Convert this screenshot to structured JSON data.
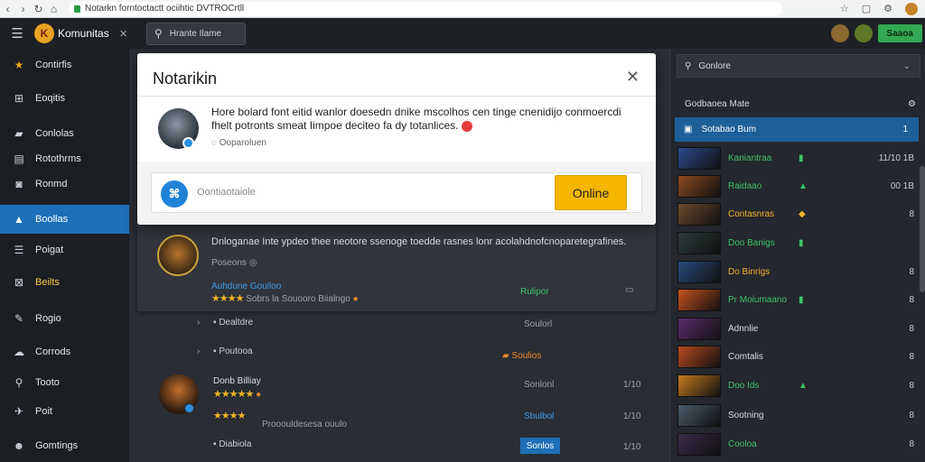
{
  "browser": {
    "url": "Notarkn forntoctactt ociihtic DVTROCrtll"
  },
  "topbar": {
    "brand": "Komunitas",
    "search_label": "Hrante Ilame",
    "button_label": "Saaoa"
  },
  "sidebar": {
    "items": [
      {
        "label": "Contirfis",
        "icon": "game-logo-icon"
      },
      {
        "label": "Eoqitis",
        "icon": "grid-icon"
      },
      {
        "label": "Conlolas",
        "icon": "folder-icon"
      },
      {
        "label": "Rotothrms",
        "icon": "calendar-icon"
      },
      {
        "label": "Ronmd",
        "icon": "chat-icon"
      },
      {
        "label": "Boollas",
        "icon": "controller-icon"
      },
      {
        "label": "Poigat",
        "icon": "list-icon"
      },
      {
        "label": "Beilts",
        "icon": "box-icon"
      },
      {
        "label": "Rogio",
        "icon": "pen-icon"
      },
      {
        "label": "Corrods",
        "icon": "cloud-icon"
      },
      {
        "label": "Tooto",
        "icon": "search-icon"
      },
      {
        "label": "Poit",
        "icon": "pin-icon"
      },
      {
        "label": "Gomtings",
        "icon": "people-icon"
      }
    ]
  },
  "modal": {
    "title": "Notarikin",
    "text": "Hore bolard font eitid wanlor doesedn dnike mscolhos cen tinge cnenidijo conmoercdi fhelt potronts smeat Iimpoe deciteo fa dy totanlices.",
    "meta": "Ooparoluen",
    "input_placeholder": "Oontiaotaiole",
    "online_button": "Online"
  },
  "feed": {
    "card": {
      "text": "Dnloganae Inte ypdeo thee neotore ssenoge toedde rasnes lonr acolahdnofcnoparetegrafines.",
      "meta": "Poseons",
      "author": "Auhdune Goulloo",
      "stars": "★★★★",
      "rating_text": "Sobrs la Souooro Biialngo",
      "tag": "Rulipor"
    },
    "rows": [
      {
        "label": "Dealtdre",
        "right": "Soulorl"
      },
      {
        "label": "Poutooa",
        "right": "Soulios"
      },
      {
        "author": "Donb Billiay",
        "stars": "★★★★★",
        "right": "Sonlonl",
        "num": "1/10"
      },
      {
        "stars": "★★★★",
        "sub": "Prooouldesesa ouulo",
        "right": "Sbulbol",
        "num": "1/10"
      },
      {
        "label": "Diabiola",
        "right": "Sonlos",
        "num": "1/10"
      }
    ]
  },
  "right_panel": {
    "search_label": "Gonlore",
    "header": "Godbaoea Mate",
    "selected": {
      "name": "Sotabao Bum",
      "count": "1"
    },
    "items": [
      {
        "name": "Kaniantraa",
        "value": "11/10 1B",
        "color": "#3ec26b"
      },
      {
        "name": "Raidaao",
        "value": "00 1B",
        "color": "#3ec26b"
      },
      {
        "name": "Contasnras",
        "value": "8",
        "color": "#f0b429"
      },
      {
        "name": "Doo Banigs",
        "value": "",
        "color": "#3ec26b"
      },
      {
        "name": "Do Binrigs",
        "value": "8",
        "color": "#f0b429"
      },
      {
        "name": "Pr Moiumaano",
        "value": "8",
        "color": "#3ec26b"
      },
      {
        "name": "Adnnlie",
        "value": "8",
        "color": "#d8dbe0"
      },
      {
        "name": "Comtalis",
        "value": "8",
        "color": "#d8dbe0"
      },
      {
        "name": "Doo Ids",
        "value": "8",
        "color": "#3ec26b"
      },
      {
        "name": "Sootning",
        "value": "8",
        "color": "#d8dbe0"
      },
      {
        "name": "Cooloa",
        "value": "8",
        "color": "#3ec26b"
      }
    ]
  }
}
